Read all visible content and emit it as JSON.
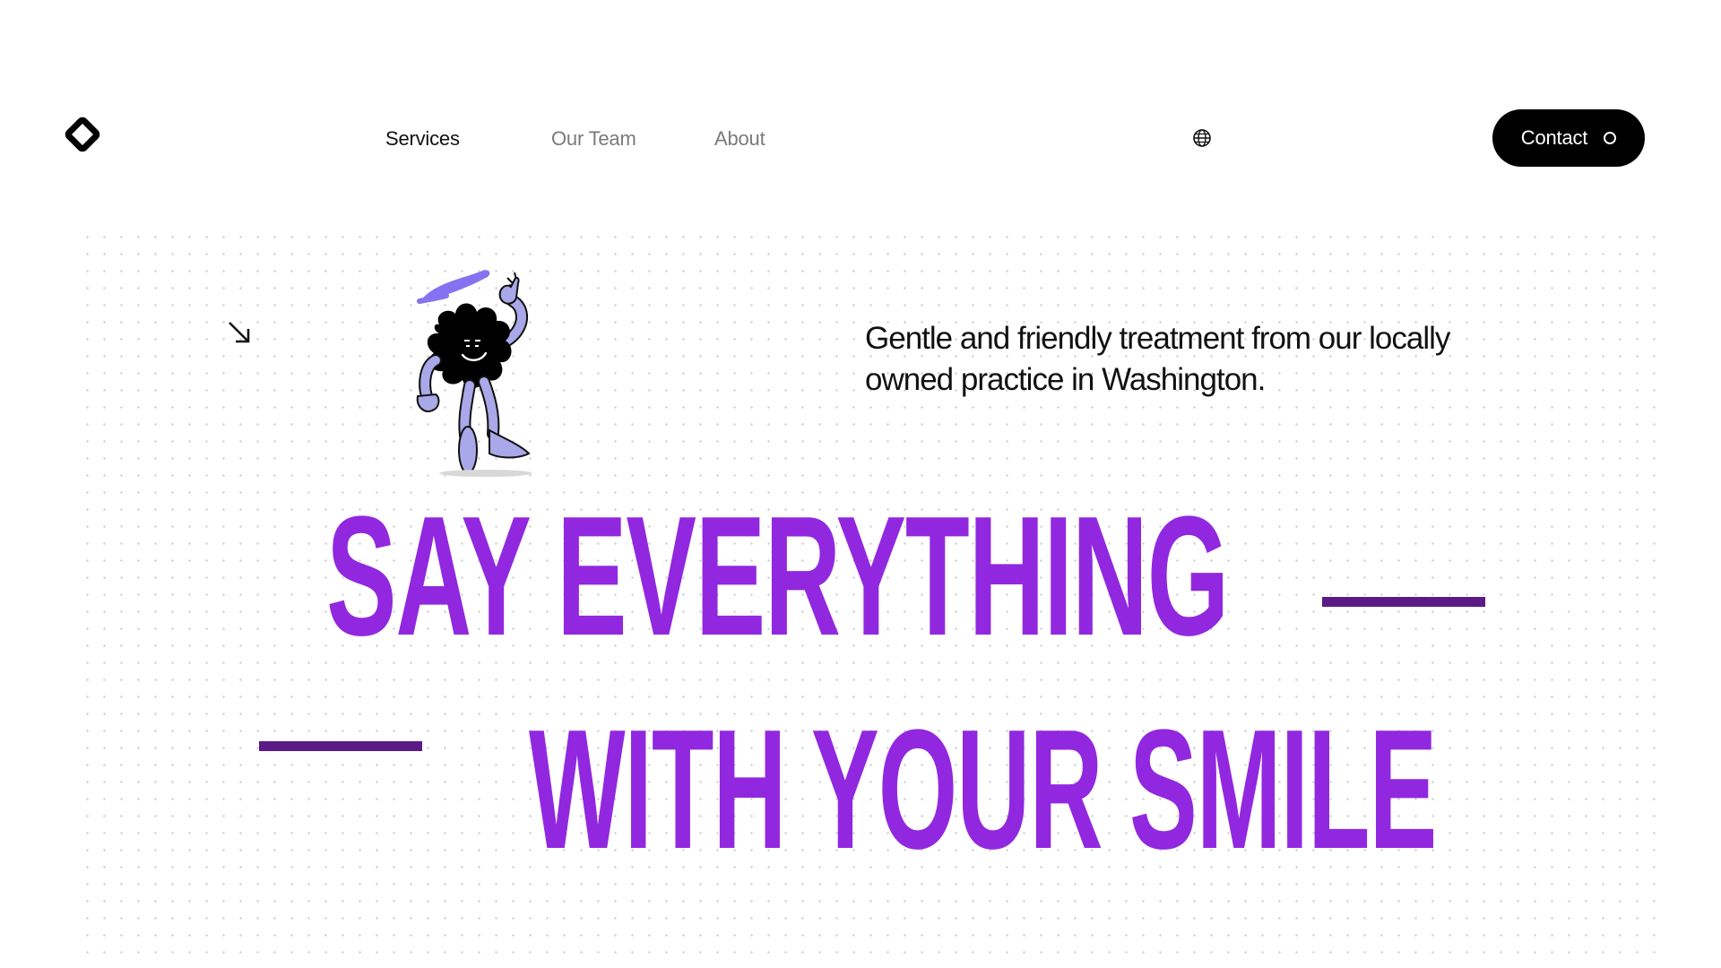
{
  "header": {
    "logo_icon": "diamond-logo-icon",
    "nav": [
      {
        "label": "Services",
        "active": true
      },
      {
        "label": "Our Team",
        "active": false
      },
      {
        "label": "About",
        "active": false
      }
    ],
    "language_icon": "globe-icon",
    "contact_label": "Contact"
  },
  "hero": {
    "arrow_icon": "arrow-down-right-icon",
    "mascot": "cartoon-tooth-mascot",
    "tagline": "Gentle and friendly treatment from our locally owned practice in Washington.",
    "headline_line1": "SAY EVERYTHING",
    "headline_line2": "WITH YOUR SMILE"
  },
  "colors": {
    "accent": "#9128e0",
    "dash": "#5b1a86",
    "button_bg": "#000000",
    "mascot_limbs": "#a9a8e8",
    "mascot_hat": "#8572f0"
  }
}
